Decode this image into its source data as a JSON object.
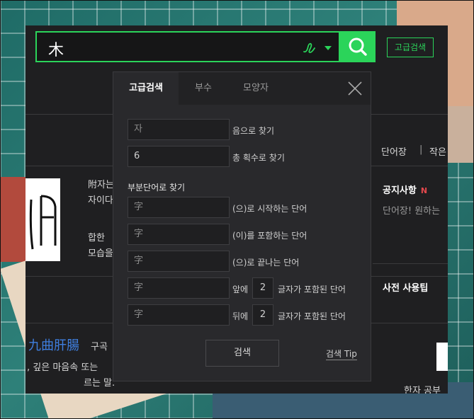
{
  "search": {
    "query": "木",
    "advanced_button": "고급검색"
  },
  "popup": {
    "tabs": [
      {
        "label": "고급검색"
      },
      {
        "label": "부수"
      },
      {
        "label": "모양자"
      }
    ],
    "reading": {
      "value": "자",
      "label": "음으로 찾기"
    },
    "strokes": {
      "value": "6",
      "label": "총 획수로 찾기"
    },
    "partial_title": "부분단어로 찾기",
    "starts": {
      "value": "字",
      "label": "(으)로 시작하는 단어"
    },
    "contains": {
      "value": "字",
      "label": "(이)를 포함하는 단어"
    },
    "ends": {
      "value": "字",
      "label": "(으)로 끝나는 단어"
    },
    "front": {
      "value": "字",
      "prefix": "앞에",
      "count": "2",
      "suffix": "글자가 포함된 단어"
    },
    "back": {
      "value": "字",
      "prefix": "뒤에",
      "count": "2",
      "suffix": "글자가 포함된 단어"
    },
    "search_button": "검색",
    "tip_link": "검색 Tip"
  },
  "sidebar": {
    "links": [
      "단어장",
      "작은"
    ],
    "notice_title": "공지사항",
    "notice_badge": "N",
    "notice_text": "단어장! 원하는 ",
    "usage_title": "사전 사용팁",
    "study": "한자 공부"
  },
  "content": {
    "lines": [
      "附자는",
      "자이다",
      "합한",
      "모습을"
    ],
    "idiom": "九曲肝腸",
    "idiom_reading": "구곡",
    "meaning1": ", 깊은 마음속 또는",
    "meaning2": "르는 말."
  }
}
